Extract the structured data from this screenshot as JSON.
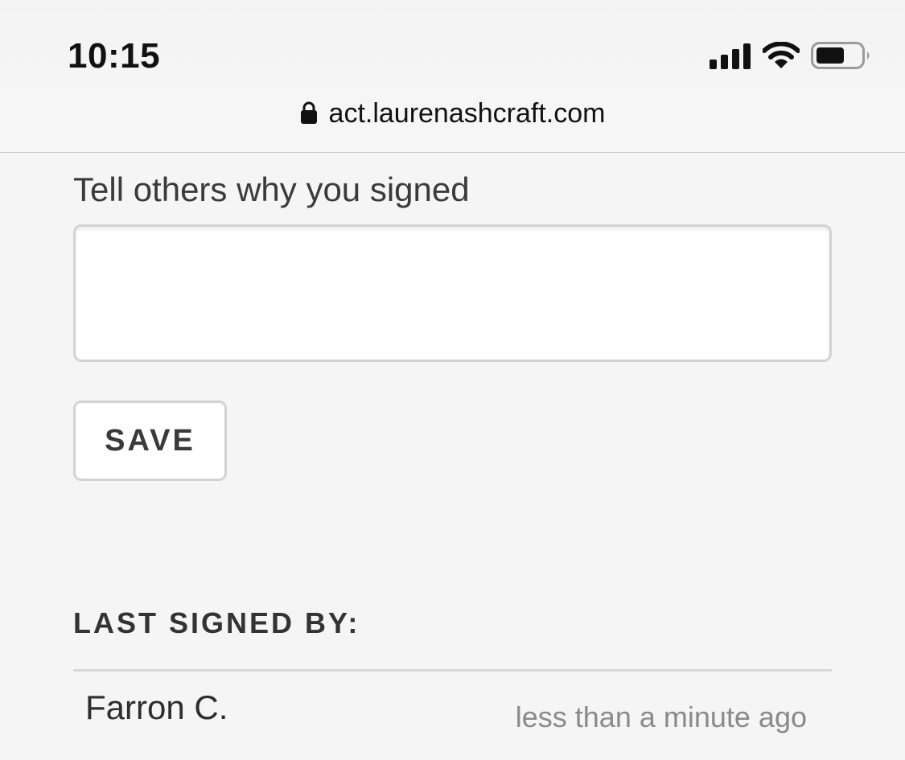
{
  "status_bar": {
    "time": "10:15",
    "icons": [
      "signal-bars-icon",
      "wifi-icon",
      "battery-icon"
    ]
  },
  "browser": {
    "url": "act.laurenashcraft.com",
    "secure_icon": "lock-icon"
  },
  "form": {
    "reason_label": "Tell others why you signed",
    "reason_value": "",
    "save_label": "SAVE"
  },
  "signers": {
    "heading": "LAST SIGNED BY:",
    "items": [
      {
        "name": "Farron C.",
        "time": "less than a minute ago"
      }
    ]
  },
  "colors": {
    "background": "#f5f5f5",
    "text": "#333333",
    "muted_text": "#8a8a8a",
    "border": "#d3d3d3"
  }
}
